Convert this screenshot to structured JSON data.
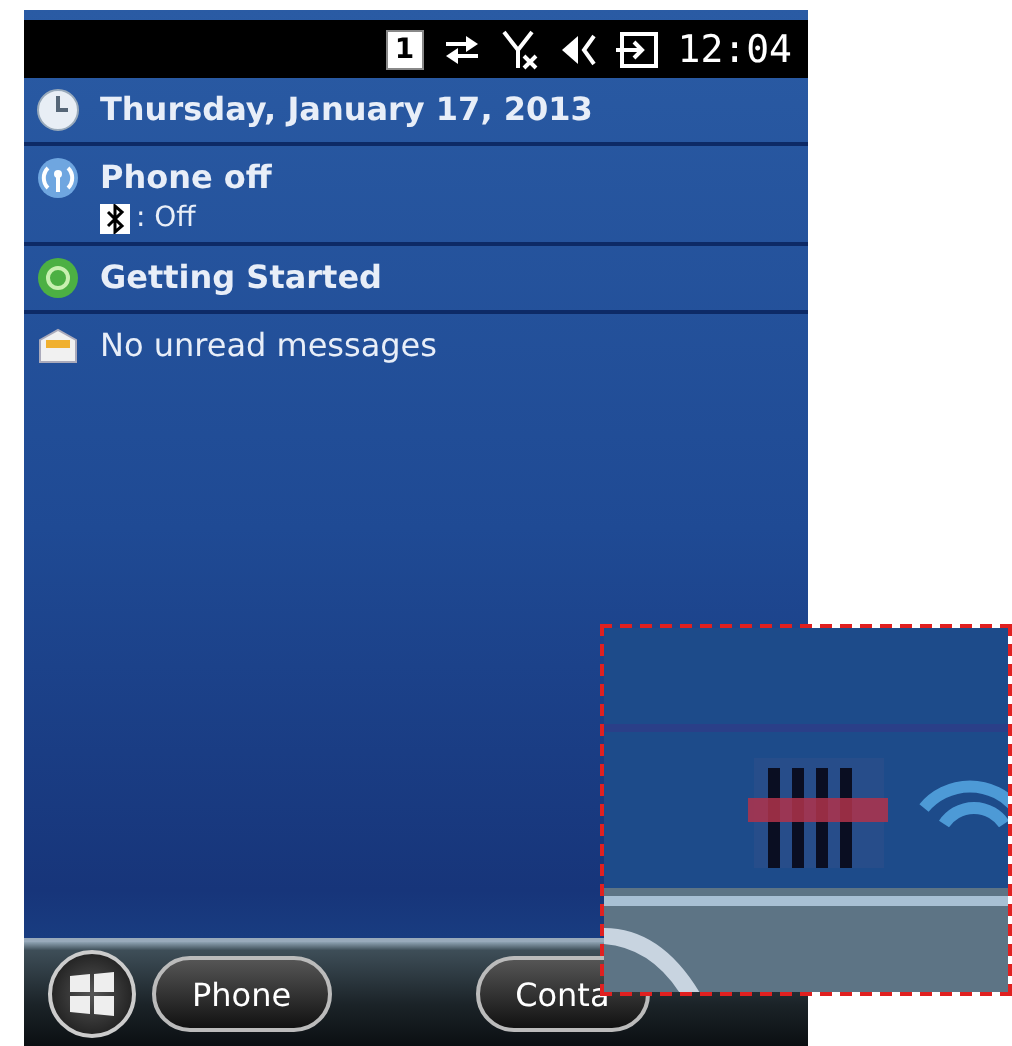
{
  "status_bar": {
    "notification_count": "1",
    "time": "12:04"
  },
  "today_items": [
    {
      "kind": "date",
      "title": "Thursday, January 17, 2013"
    },
    {
      "kind": "phone",
      "title": "Phone off",
      "detail": ": Off"
    },
    {
      "kind": "start",
      "title": "Getting Started"
    },
    {
      "kind": "mail",
      "title": "No unread messages"
    }
  ],
  "taskbar": {
    "buttons": [
      "Phone",
      "Conta"
    ]
  }
}
